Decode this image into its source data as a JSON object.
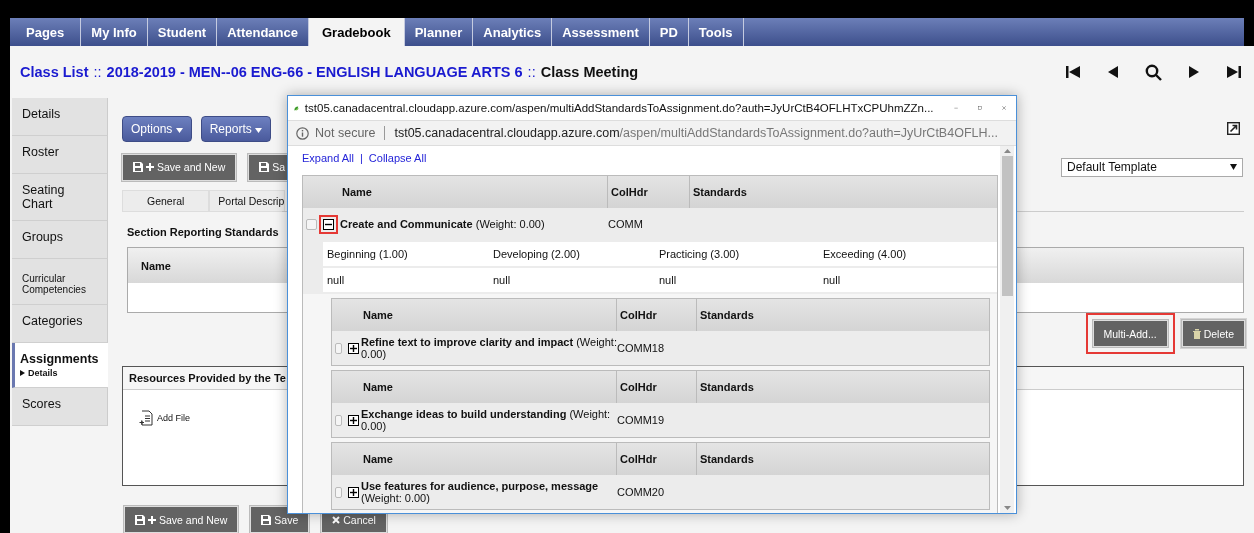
{
  "nav_tabs": [
    {
      "label": "Pages",
      "selected": false
    },
    {
      "label": "My Info",
      "selected": false
    },
    {
      "label": "Student",
      "selected": false
    },
    {
      "label": "Attendance",
      "selected": false
    },
    {
      "label": "Gradebook",
      "selected": true
    },
    {
      "label": "Planner",
      "selected": false
    },
    {
      "label": "Analytics",
      "selected": false
    },
    {
      "label": "Assessment",
      "selected": false
    },
    {
      "label": "PD",
      "selected": false
    },
    {
      "label": "Tools",
      "selected": false
    }
  ],
  "breadcrumb": [
    {
      "label": "Class List",
      "kind": "link"
    },
    {
      "label": "::",
      "kind": "sep"
    },
    {
      "label": "2018-2019 - MEN--06 ENG-66 - ENGLISH LANGUAGE ARTS 6",
      "kind": "link"
    },
    {
      "label": "::",
      "kind": "sep"
    },
    {
      "label": "Class Meeting",
      "kind": "current"
    }
  ],
  "sidebar": {
    "items": [
      {
        "label": "Details",
        "kind": "normal",
        "selected": false
      },
      {
        "label": "Roster",
        "kind": "normal",
        "selected": false
      },
      {
        "label": "Seating Chart",
        "kind": "normal",
        "selected": false
      },
      {
        "label": "Groups",
        "kind": "normal",
        "selected": false
      },
      {
        "label": "Curricular Competencies",
        "kind": "small",
        "selected": false
      },
      {
        "label": "Categories",
        "kind": "normal",
        "selected": false
      },
      {
        "label": "Assignments",
        "kind": "normal",
        "selected": true,
        "sub": "Details"
      },
      {
        "label": "Scores",
        "kind": "normal",
        "selected": false
      }
    ]
  },
  "menu_buttons": [
    "Options",
    "Reports"
  ],
  "top_buttons": [
    {
      "label": "Save and New",
      "kind": "save-new"
    },
    {
      "label": "Sa",
      "kind": "save"
    }
  ],
  "sub_tabs": [
    "General",
    "Portal Descrip"
  ],
  "template_select": {
    "value": "Default Template"
  },
  "section_title": "Section Reporting Standards",
  "standards_table": {
    "columns": [
      "Name"
    ]
  },
  "standards_buttons": [
    {
      "label": "Multi-Add...",
      "kind": "plain",
      "highlighted": true
    },
    {
      "label": "Delete",
      "kind": "delete",
      "highlighted": false
    }
  ],
  "resources": {
    "title": "Resources Provided by the Te",
    "add_file": "Add File"
  },
  "bottom_buttons": [
    {
      "label": "Save and New",
      "kind": "save-new"
    },
    {
      "label": "Save",
      "kind": "save"
    },
    {
      "label": "Cancel",
      "kind": "cancel"
    }
  ],
  "popup": {
    "title": "tst05.canadacentral.cloudapp.azure.com/aspen/multiAddStandardsToAssignment.do?auth=JyUrCtB4OFLHTxCPUhmZZn...",
    "security": "Not secure",
    "url_host": "tst05.canadacentral.cloudapp.azure.com",
    "url_path": "/aspen/multiAddStandardsToAssignment.do?auth=JyUrCtB4OFLH...",
    "links": [
      "Expand All",
      "|",
      "Collapse All"
    ],
    "columns": [
      "Name",
      "ColHdr",
      "Standards"
    ],
    "parent": {
      "name": "Create and Communicate",
      "weight": "(Weight: 0.00)",
      "colhdr": "COMM",
      "expanded": true,
      "highlighted": true,
      "checked": false
    },
    "levels": [
      {
        "label": "Beginning (1.00)",
        "value": "null"
      },
      {
        "label": "Developing (2.00)",
        "value": "null"
      },
      {
        "label": "Practicing (3.00)",
        "value": "null"
      },
      {
        "label": "Exceeding (4.00)",
        "value": "null"
      }
    ],
    "children": [
      {
        "columns": [
          "Name",
          "ColHdr",
          "Standards"
        ],
        "name": "Refine text to improve clarity and impact",
        "weight": "(Weight: 0.00)",
        "colhdr": "COMM18",
        "expanded": false,
        "checked": false
      },
      {
        "columns": [
          "Name",
          "ColHdr",
          "Standards"
        ],
        "name": "Exchange ideas to build understanding",
        "weight": "(Weight: 0.00)",
        "colhdr": "COMM19",
        "expanded": false,
        "checked": false
      },
      {
        "columns": [
          "Name",
          "ColHdr",
          "Standards"
        ],
        "name": "Use features for audience, purpose, message",
        "weight": "(Weight: 0.00)",
        "colhdr": "COMM20",
        "expanded": false,
        "checked": false
      }
    ]
  }
}
